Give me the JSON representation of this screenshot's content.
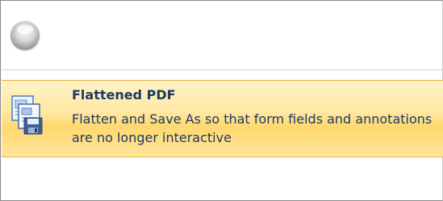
{
  "menu": {
    "items": [
      {
        "title": "Flattened PDF",
        "description": "Flatten and Save As so that form fields and annotations are no longer interactive",
        "icon": "flattened-pdf-icon",
        "state": "hover"
      }
    ]
  },
  "colors": {
    "highlight_top": "#fff3c6",
    "highlight_bottom": "#ffd86f",
    "highlight_border": "#e7b24a",
    "text": "#1b3a66"
  }
}
